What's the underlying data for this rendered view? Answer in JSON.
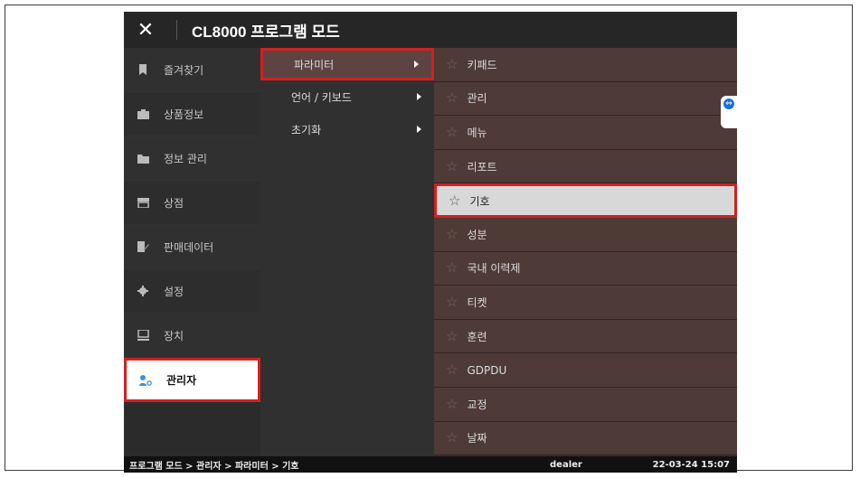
{
  "titlebar": {
    "close_icon": "close-icon",
    "title": "CL8000 프로그램 모드"
  },
  "sidebar": {
    "items": [
      {
        "label": "즐겨찾기",
        "icon": "bookmark-icon"
      },
      {
        "label": "상품정보",
        "icon": "product-icon"
      },
      {
        "label": "정보 관리",
        "icon": "folder-icon"
      },
      {
        "label": "상점",
        "icon": "store-icon"
      },
      {
        "label": "판매데이터",
        "icon": "sales-data-icon"
      },
      {
        "label": "설정",
        "icon": "gear-icon"
      },
      {
        "label": "장치",
        "icon": "device-icon"
      },
      {
        "label": "관리자",
        "icon": "admin-icon",
        "active": true
      }
    ]
  },
  "submenu": {
    "items": [
      {
        "label": "파라미터",
        "selected": true
      },
      {
        "label": "언어 / 키보드"
      },
      {
        "label": "초기화"
      }
    ]
  },
  "params": {
    "items": [
      {
        "label": "키패드"
      },
      {
        "label": "관리"
      },
      {
        "label": "메뉴"
      },
      {
        "label": "리포트"
      },
      {
        "label": "기호",
        "selected": true
      },
      {
        "label": "성분"
      },
      {
        "label": "국내 이력제"
      },
      {
        "label": "티켓"
      },
      {
        "label": "훈련"
      },
      {
        "label": "GDPDU"
      },
      {
        "label": "교정"
      },
      {
        "label": "날짜"
      }
    ]
  },
  "statusbar": {
    "breadcrumb": "프로그램 모드 > 관리자 > 파라미터 > 기호",
    "user": "dealer",
    "datetime": "22-03-24 15:07"
  },
  "colors": {
    "highlight_border": "#d32020",
    "titlebar_bg": "#262626",
    "param_bg": "#4e3a37",
    "selected_bg": "#d8d8d8"
  }
}
